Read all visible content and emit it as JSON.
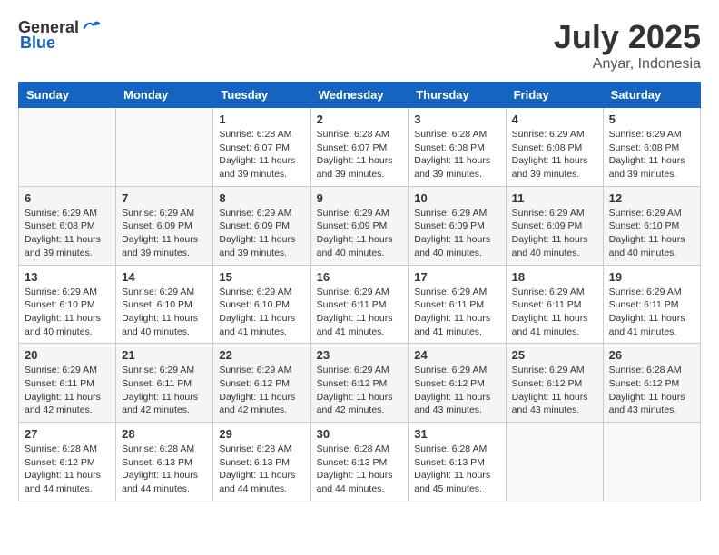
{
  "header": {
    "logo_general": "General",
    "logo_blue": "Blue",
    "month": "July 2025",
    "location": "Anyar, Indonesia"
  },
  "weekdays": [
    "Sunday",
    "Monday",
    "Tuesday",
    "Wednesday",
    "Thursday",
    "Friday",
    "Saturday"
  ],
  "weeks": [
    [
      {
        "day": "",
        "info": ""
      },
      {
        "day": "",
        "info": ""
      },
      {
        "day": "1",
        "info": "Sunrise: 6:28 AM\nSunset: 6:07 PM\nDaylight: 11 hours and 39 minutes."
      },
      {
        "day": "2",
        "info": "Sunrise: 6:28 AM\nSunset: 6:07 PM\nDaylight: 11 hours and 39 minutes."
      },
      {
        "day": "3",
        "info": "Sunrise: 6:28 AM\nSunset: 6:08 PM\nDaylight: 11 hours and 39 minutes."
      },
      {
        "day": "4",
        "info": "Sunrise: 6:29 AM\nSunset: 6:08 PM\nDaylight: 11 hours and 39 minutes."
      },
      {
        "day": "5",
        "info": "Sunrise: 6:29 AM\nSunset: 6:08 PM\nDaylight: 11 hours and 39 minutes."
      }
    ],
    [
      {
        "day": "6",
        "info": "Sunrise: 6:29 AM\nSunset: 6:08 PM\nDaylight: 11 hours and 39 minutes."
      },
      {
        "day": "7",
        "info": "Sunrise: 6:29 AM\nSunset: 6:09 PM\nDaylight: 11 hours and 39 minutes."
      },
      {
        "day": "8",
        "info": "Sunrise: 6:29 AM\nSunset: 6:09 PM\nDaylight: 11 hours and 39 minutes."
      },
      {
        "day": "9",
        "info": "Sunrise: 6:29 AM\nSunset: 6:09 PM\nDaylight: 11 hours and 40 minutes."
      },
      {
        "day": "10",
        "info": "Sunrise: 6:29 AM\nSunset: 6:09 PM\nDaylight: 11 hours and 40 minutes."
      },
      {
        "day": "11",
        "info": "Sunrise: 6:29 AM\nSunset: 6:09 PM\nDaylight: 11 hours and 40 minutes."
      },
      {
        "day": "12",
        "info": "Sunrise: 6:29 AM\nSunset: 6:10 PM\nDaylight: 11 hours and 40 minutes."
      }
    ],
    [
      {
        "day": "13",
        "info": "Sunrise: 6:29 AM\nSunset: 6:10 PM\nDaylight: 11 hours and 40 minutes."
      },
      {
        "day": "14",
        "info": "Sunrise: 6:29 AM\nSunset: 6:10 PM\nDaylight: 11 hours and 40 minutes."
      },
      {
        "day": "15",
        "info": "Sunrise: 6:29 AM\nSunset: 6:10 PM\nDaylight: 11 hours and 41 minutes."
      },
      {
        "day": "16",
        "info": "Sunrise: 6:29 AM\nSunset: 6:11 PM\nDaylight: 11 hours and 41 minutes."
      },
      {
        "day": "17",
        "info": "Sunrise: 6:29 AM\nSunset: 6:11 PM\nDaylight: 11 hours and 41 minutes."
      },
      {
        "day": "18",
        "info": "Sunrise: 6:29 AM\nSunset: 6:11 PM\nDaylight: 11 hours and 41 minutes."
      },
      {
        "day": "19",
        "info": "Sunrise: 6:29 AM\nSunset: 6:11 PM\nDaylight: 11 hours and 41 minutes."
      }
    ],
    [
      {
        "day": "20",
        "info": "Sunrise: 6:29 AM\nSunset: 6:11 PM\nDaylight: 11 hours and 42 minutes."
      },
      {
        "day": "21",
        "info": "Sunrise: 6:29 AM\nSunset: 6:11 PM\nDaylight: 11 hours and 42 minutes."
      },
      {
        "day": "22",
        "info": "Sunrise: 6:29 AM\nSunset: 6:12 PM\nDaylight: 11 hours and 42 minutes."
      },
      {
        "day": "23",
        "info": "Sunrise: 6:29 AM\nSunset: 6:12 PM\nDaylight: 11 hours and 42 minutes."
      },
      {
        "day": "24",
        "info": "Sunrise: 6:29 AM\nSunset: 6:12 PM\nDaylight: 11 hours and 43 minutes."
      },
      {
        "day": "25",
        "info": "Sunrise: 6:29 AM\nSunset: 6:12 PM\nDaylight: 11 hours and 43 minutes."
      },
      {
        "day": "26",
        "info": "Sunrise: 6:28 AM\nSunset: 6:12 PM\nDaylight: 11 hours and 43 minutes."
      }
    ],
    [
      {
        "day": "27",
        "info": "Sunrise: 6:28 AM\nSunset: 6:12 PM\nDaylight: 11 hours and 44 minutes."
      },
      {
        "day": "28",
        "info": "Sunrise: 6:28 AM\nSunset: 6:13 PM\nDaylight: 11 hours and 44 minutes."
      },
      {
        "day": "29",
        "info": "Sunrise: 6:28 AM\nSunset: 6:13 PM\nDaylight: 11 hours and 44 minutes."
      },
      {
        "day": "30",
        "info": "Sunrise: 6:28 AM\nSunset: 6:13 PM\nDaylight: 11 hours and 44 minutes."
      },
      {
        "day": "31",
        "info": "Sunrise: 6:28 AM\nSunset: 6:13 PM\nDaylight: 11 hours and 45 minutes."
      },
      {
        "day": "",
        "info": ""
      },
      {
        "day": "",
        "info": ""
      }
    ]
  ]
}
